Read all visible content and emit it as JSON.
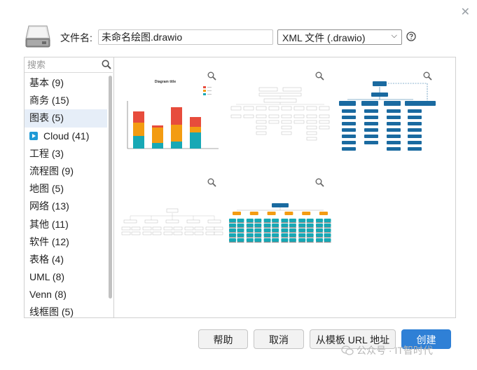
{
  "header": {
    "filename_label": "文件名:",
    "filename_value": "未命名绘图.drawio",
    "format_selected": "XML 文件 (.drawio)"
  },
  "sidebar": {
    "search_placeholder": "搜索",
    "categories": [
      {
        "label": "基本 (9)"
      },
      {
        "label": "商务 (15)"
      },
      {
        "label": "图表 (5)",
        "selected": true
      },
      {
        "label": "Cloud (41)",
        "icon": "play-badge-icon"
      },
      {
        "label": "工程 (3)"
      },
      {
        "label": "流程图 (9)"
      },
      {
        "label": "地图 (5)"
      },
      {
        "label": "网络 (13)"
      },
      {
        "label": "其他 (11)"
      },
      {
        "label": "软件 (12)"
      },
      {
        "label": "表格 (4)"
      },
      {
        "label": "UML (8)"
      },
      {
        "label": "Venn (8)"
      },
      {
        "label": "线框图 (5)"
      }
    ]
  },
  "templates": {
    "bar_chart_title": "Diagram title",
    "items": [
      "bar-chart",
      "org-chart-gray",
      "org-chart-blue",
      "tree-chart-gray",
      "org-chart-orange-teal"
    ]
  },
  "buttons": {
    "help": "帮助",
    "cancel": "取消",
    "from_url": "从模板 URL 地址",
    "create": "创建"
  },
  "watermark": "公众号 · IT智时代",
  "colors": {
    "accent": "#2f80d6",
    "bar_red": "#e74c3c",
    "bar_orange": "#f39c12",
    "bar_teal": "#17a8b5",
    "org_blue": "#1a6aa0",
    "selected_bg": "#e6eef8"
  },
  "icons": [
    "disk-icon",
    "help-icon",
    "search-icon",
    "zoom-icon",
    "close-icon"
  ]
}
